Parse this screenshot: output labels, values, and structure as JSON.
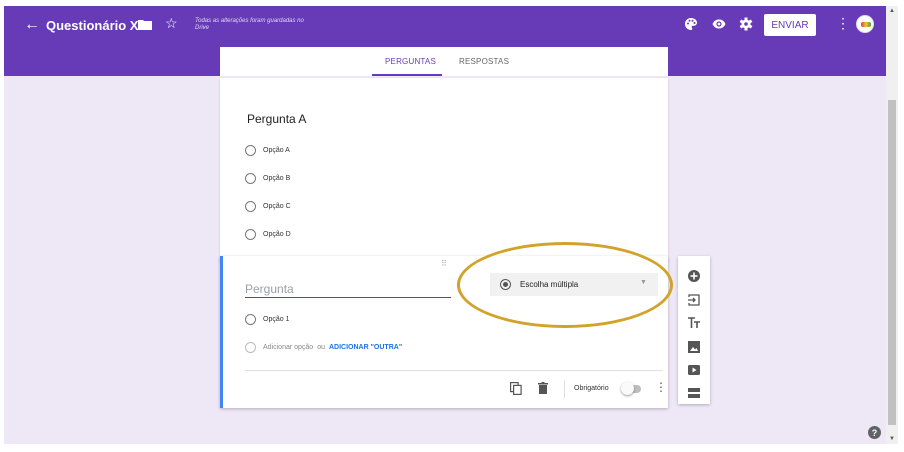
{
  "header": {
    "back_glyph": "←",
    "title": "Questionário X",
    "save_status": "Todas as alterações foram guardadas no Drive",
    "send_label": "ENVIAR",
    "more_glyph": "⋮"
  },
  "tabs": [
    {
      "label": "PERGUNTAS",
      "active": true
    },
    {
      "label": "RESPOSTAS",
      "active": false
    }
  ],
  "question_a": {
    "title": "Pergunta A",
    "options": [
      "Opção A",
      "Opção B",
      "Opção C",
      "Opção D"
    ]
  },
  "question_b": {
    "drag_handle": "⠿",
    "title_placeholder": "Pergunta",
    "type_label": "Escolha múltipla",
    "type_caret": "▼",
    "options": [
      "Opção 1"
    ],
    "add_option": "Adicionar opção",
    "or_text": "ou",
    "add_other": "ADICIONAR \"OUTRA\"",
    "required_label": "Obrigatório",
    "required_on": false,
    "more_glyph": "⋮"
  },
  "help_glyph": "?",
  "scroll": {
    "up": "▲",
    "down": "▼"
  },
  "colors": {
    "primary": "#673ab7",
    "background": "#ede7f6",
    "accent_blue": "#4285f4",
    "highlight_ellipse": "#d2a32a"
  },
  "icons": {
    "top": [
      "arrow-left-icon",
      "folder-icon",
      "star-icon",
      "palette-icon",
      "eye-icon",
      "gear-icon",
      "more-vert-icon",
      "avatar"
    ],
    "side": [
      "add-circle-icon",
      "import-icon",
      "title-icon",
      "image-icon",
      "video-icon",
      "section-icon"
    ],
    "card": [
      "duplicate-icon",
      "trash-icon"
    ]
  }
}
